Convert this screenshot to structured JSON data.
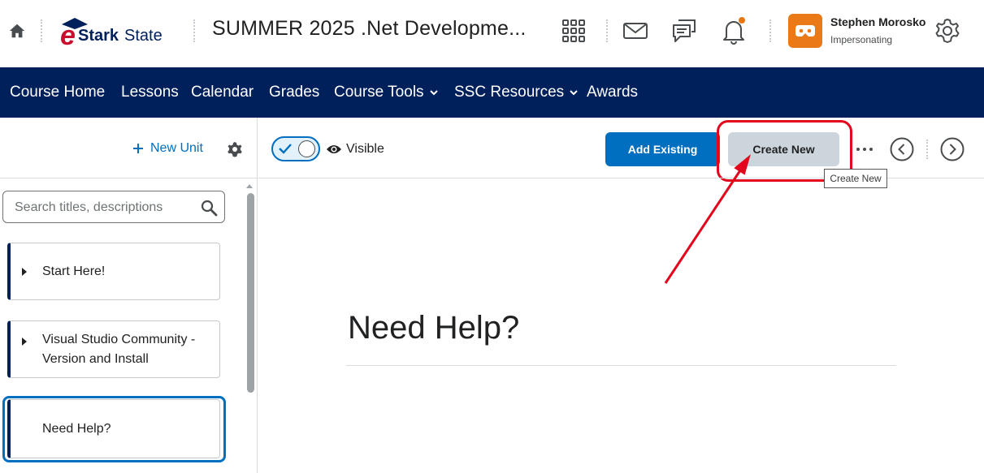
{
  "header": {
    "logo_text": "eStarkState",
    "course_title": "SUMMER 2025 .Net Developme...",
    "icons": [
      "home-icon",
      "apps-grid-icon",
      "mail-icon",
      "chat-icon",
      "bell-icon",
      "gear-icon"
    ],
    "user": {
      "name": "Stephen Morosko",
      "role": "Impersonating"
    }
  },
  "nav": {
    "items": [
      {
        "label": "Course Home"
      },
      {
        "label": "Lessons"
      },
      {
        "label": "Calendar"
      },
      {
        "label": "Grades"
      },
      {
        "label": "Course Tools"
      },
      {
        "label": "SSC Resources"
      },
      {
        "label": "Awards"
      }
    ],
    "color": "#00205b"
  },
  "sidebar": {
    "new_unit_label": "New Unit",
    "search": {
      "placeholder": "Search titles, descriptions"
    },
    "units": [
      {
        "title": "Start Here!"
      },
      {
        "title": "Visual Studio Community - Version and Install Information"
      },
      {
        "title": "Need Help?"
      }
    ]
  },
  "toolbar": {
    "visibility_label": "Visible",
    "add_existing_label": "Add Existing",
    "create_new_label": "Create New",
    "tooltip": "Create New",
    "accent_color": "#006fbf",
    "highlight_color": "#e3051b"
  },
  "content": {
    "heading": "Need Help?"
  }
}
